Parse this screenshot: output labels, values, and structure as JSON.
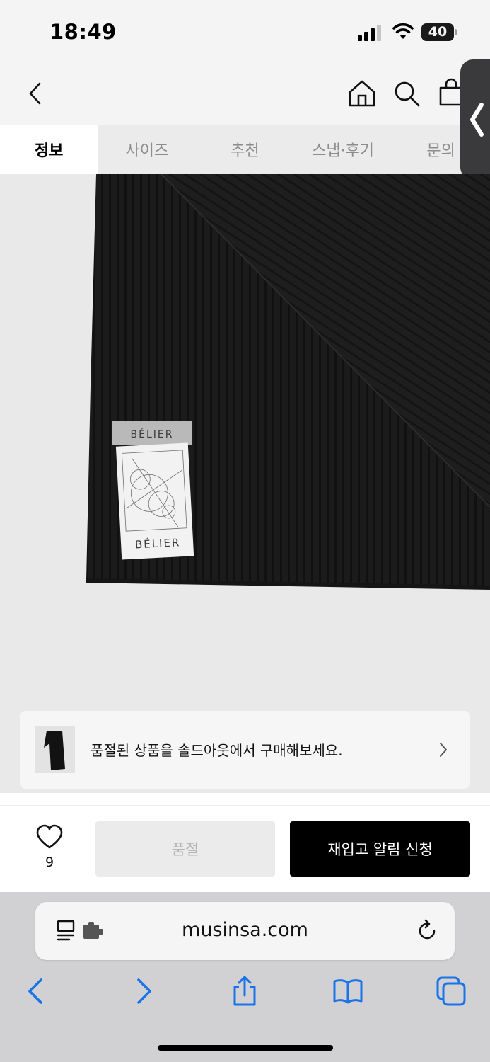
{
  "status_bar": {
    "time": "18:49",
    "battery_level": "40",
    "icons": [
      "signal-icon",
      "wifi-icon",
      "battery-icon"
    ]
  },
  "header": {
    "icons": [
      "back-icon",
      "home-icon",
      "search-icon",
      "cart-icon"
    ]
  },
  "tabs": [
    {
      "label": "정보",
      "active": true
    },
    {
      "label": "사이즈",
      "active": false
    },
    {
      "label": "추천",
      "active": false
    },
    {
      "label": "스냅·후기",
      "active": false
    },
    {
      "label": "문의",
      "active": false
    }
  ],
  "product_image": {
    "label_brand_top": "BÉLIER",
    "label_brand_bottom": "BÉLIER"
  },
  "soldout_banner": {
    "text": "품절된 상품을 솔드아웃에서 구매해보세요.",
    "icon": "chevron-right-icon"
  },
  "purchase_bar": {
    "like_count": "9",
    "soldout_label": "품절",
    "restock_label": "재입고 알림 신청"
  },
  "browser": {
    "url": "musinsa.com",
    "icons": [
      "reader-icon",
      "extension-icon",
      "reload-icon",
      "back-icon",
      "forward-icon",
      "share-icon",
      "bookmarks-icon",
      "tabs-icon"
    ]
  },
  "colors": {
    "accent": "#000000",
    "safari_blue": "#1a73e8",
    "tab_bg": "#ebebeb",
    "disabled_text": "#b3b3b3"
  }
}
